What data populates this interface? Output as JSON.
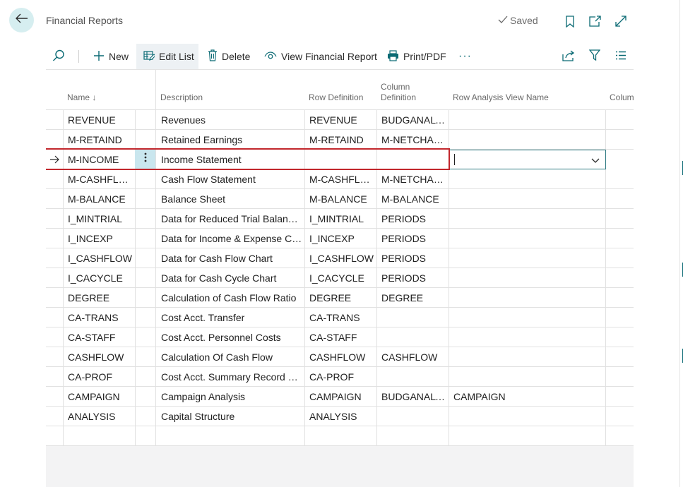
{
  "header": {
    "title": "Financial Reports",
    "saved_label": "Saved"
  },
  "toolbar": {
    "new_label": "New",
    "edit_list_label": "Edit List",
    "delete_label": "Delete",
    "view_report_label": "View Financial Report",
    "print_label": "Print/PDF",
    "more_label": "···"
  },
  "columns": {
    "name": "Name ↓",
    "description": "Description",
    "row_definition": "Row Definition",
    "column_definition_1": "Column",
    "column_definition_2": "Definition",
    "row_analysis": "Row Analysis View Name",
    "column_partial": "Colum"
  },
  "rows": [
    {
      "name": "REVENUE",
      "desc": "Revenues",
      "rowdef": "REVENUE",
      "coldef": "BUDGANALYS",
      "rowan": ""
    },
    {
      "name": "M-RETAIND",
      "desc": "Retained Earnings",
      "rowdef": "M-RETAIND",
      "coldef": "M-NETCHANG",
      "rowan": ""
    },
    {
      "name": "M-INCOME",
      "desc": "Income Statement",
      "rowdef": "",
      "coldef": "",
      "rowan": "",
      "selected": true
    },
    {
      "name": "M-CASHFLOW",
      "desc": "Cash Flow Statement",
      "rowdef": "M-CASHFLOW",
      "coldef": "M-NETCHANG",
      "rowan": ""
    },
    {
      "name": "M-BALANCE",
      "desc": "Balance Sheet",
      "rowdef": "M-BALANCE",
      "coldef": "M-BALANCE",
      "rowan": ""
    },
    {
      "name": "I_MINTRIAL",
      "desc": "Data for Reduced Trial Balance...",
      "rowdef": "I_MINTRIAL",
      "coldef": "PERIODS",
      "rowan": ""
    },
    {
      "name": "I_INCEXP",
      "desc": "Data for Income & Expense Ch...",
      "rowdef": "I_INCEXP",
      "coldef": "PERIODS",
      "rowan": ""
    },
    {
      "name": "I_CASHFLOW",
      "desc": "Data for Cash Flow Chart",
      "rowdef": "I_CASHFLOW",
      "coldef": "PERIODS",
      "rowan": ""
    },
    {
      "name": "I_CACYCLE",
      "desc": "Data for Cash Cycle Chart",
      "rowdef": "I_CACYCLE",
      "coldef": "PERIODS",
      "rowan": ""
    },
    {
      "name": "DEGREE",
      "desc": "Calculation of Cash Flow Ratio",
      "rowdef": "DEGREE",
      "coldef": "DEGREE",
      "rowan": ""
    },
    {
      "name": "CA-TRANS",
      "desc": "Cost Acct. Transfer",
      "rowdef": "CA-TRANS",
      "coldef": "",
      "rowan": ""
    },
    {
      "name": "CA-STAFF",
      "desc": "Cost Acct. Personnel Costs",
      "rowdef": "CA-STAFF",
      "coldef": "",
      "rowan": ""
    },
    {
      "name": "CASHFLOW",
      "desc": "Calculation Of Cash Flow",
      "rowdef": "CASHFLOW",
      "coldef": "CASHFLOW",
      "rowan": ""
    },
    {
      "name": "CA-PROF",
      "desc": "Cost Acct. Summary Record D...",
      "rowdef": "CA-PROF",
      "coldef": "",
      "rowan": ""
    },
    {
      "name": "CAMPAIGN",
      "desc": "Campaign Analysis",
      "rowdef": "CAMPAIGN",
      "coldef": "BUDGANALYS",
      "rowan": "CAMPAIGN"
    },
    {
      "name": "ANALYSIS",
      "desc": "Capital Structure",
      "rowdef": "ANALYSIS",
      "coldef": "",
      "rowan": ""
    },
    {
      "name": "",
      "desc": "",
      "rowdef": "",
      "coldef": "",
      "rowan": ""
    }
  ],
  "colors": {
    "accent": "#0a6a74",
    "selection_border": "#c2272d",
    "selected_cell": "#c9e6ee"
  }
}
